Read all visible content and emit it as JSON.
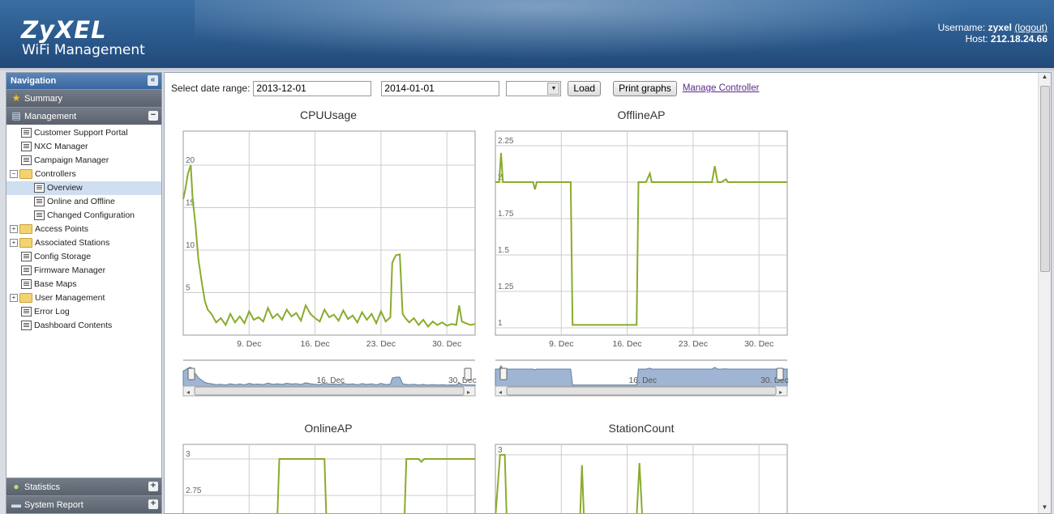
{
  "header": {
    "brand": "ZyXEL",
    "subtitle": "WiFi Management",
    "username_label": "Username:",
    "username": "zyxel",
    "logout": "(logout)",
    "host_label": "Host:",
    "host": "212.18.24.66"
  },
  "sidebar": {
    "title": "Navigation",
    "sections": {
      "summary": "Summary",
      "management": "Management",
      "statistics": "Statistics",
      "system_report": "System Report"
    },
    "items": [
      {
        "label": "Customer Support Portal"
      },
      {
        "label": "NXC Manager"
      },
      {
        "label": "Campaign Manager"
      },
      {
        "label": "Controllers"
      },
      {
        "label": "Overview"
      },
      {
        "label": "Online and Offline"
      },
      {
        "label": "Changed Configuration"
      },
      {
        "label": "Access Points"
      },
      {
        "label": "Associated Stations"
      },
      {
        "label": "Config Storage"
      },
      {
        "label": "Firmware Manager"
      },
      {
        "label": "Base Maps"
      },
      {
        "label": "User Management"
      },
      {
        "label": "Error Log"
      },
      {
        "label": "Dashboard Contents"
      }
    ]
  },
  "toolbar": {
    "date_label": "Select date range:",
    "start_date": "2013-12-01",
    "end_date": "2014-01-01",
    "select_value": "",
    "load": "Load",
    "print": "Print graphs",
    "manage": "Manage Controller"
  },
  "colors": {
    "line": "#8aab2c",
    "nav_fill": "#9fb5d3",
    "header": "#2b5a8d"
  },
  "chart_data": [
    {
      "type": "line",
      "title": "CPUUsage",
      "x_ticks": [
        "9. Dec",
        "16. Dec",
        "23. Dec",
        "30. Dec"
      ],
      "y_ticks": [
        "5",
        "10",
        "15",
        "20"
      ],
      "ylim": [
        0,
        24
      ],
      "x": [
        1,
        1.2,
        1.5,
        1.8,
        2,
        2.3,
        2.6,
        3,
        3.3,
        3.6,
        4,
        4.5,
        5,
        5.5,
        6,
        6.5,
        7,
        7.5,
        8,
        8.5,
        9,
        9.5,
        10,
        10.5,
        11,
        11.5,
        12,
        12.5,
        13,
        13.5,
        14,
        14.5,
        15,
        15.5,
        16,
        16.5,
        17,
        17.5,
        18,
        18.5,
        19,
        19.5,
        20,
        20.5,
        21,
        21.5,
        22,
        22.5,
        23,
        23.2,
        23.4,
        23.6,
        24,
        24.3,
        24.6,
        25,
        25.5,
        26,
        26.5,
        27,
        27.5,
        28,
        28.5,
        29,
        29.5,
        30,
        30.3,
        30.6,
        31,
        31.5,
        32
      ],
      "values": [
        16,
        17,
        19,
        20,
        16,
        13,
        9,
        6,
        4,
        3,
        2.5,
        1.5,
        2,
        1.2,
        2.5,
        1.5,
        2.2,
        1.4,
        2.8,
        1.8,
        2.1,
        1.6,
        3.2,
        2.0,
        2.5,
        1.8,
        3.0,
        2.2,
        2.6,
        1.7,
        3.5,
        2.5,
        2.0,
        1.6,
        3.0,
        2.1,
        2.4,
        1.7,
        2.9,
        1.9,
        2.3,
        1.5,
        2.7,
        1.8,
        2.5,
        1.4,
        2.8,
        1.6,
        2.1,
        8.5,
        9.0,
        9.4,
        9.5,
        2.5,
        2.0,
        1.5,
        2.0,
        1.2,
        1.8,
        1.0,
        1.6,
        1.2,
        1.5,
        1.1,
        1.3,
        1.2,
        3.5,
        1.6,
        1.4,
        1.2,
        1.3
      ]
    },
    {
      "type": "line",
      "title": "OfflineAP",
      "x_ticks": [
        "9. Dec",
        "16. Dec",
        "23. Dec",
        "30. Dec"
      ],
      "y_ticks": [
        "1",
        "1.25",
        "1.5",
        "1.75",
        "2",
        "2.25"
      ],
      "ylim": [
        0.95,
        2.35
      ],
      "x": [
        1,
        1.4,
        1.6,
        1.8,
        3,
        5,
        5.2,
        5.4,
        7,
        9,
        9.2,
        11,
        11.2,
        13,
        16,
        16.2,
        16.4,
        17,
        17.4,
        17.6,
        18,
        23,
        24,
        24.3,
        24.6,
        25,
        25.5,
        25.7,
        26,
        32
      ],
      "values": [
        2,
        2,
        2.2,
        2,
        2,
        2,
        1.95,
        2,
        2,
        2,
        1.02,
        1.02,
        1.02,
        1.02,
        1.02,
        2,
        2,
        2,
        2.06,
        2,
        2,
        2,
        2,
        2.11,
        2,
        2,
        2.02,
        2,
        2,
        2
      ]
    },
    {
      "type": "line",
      "title": "OnlineAP",
      "x_ticks": [],
      "y_ticks": [
        "2.75",
        "3"
      ],
      "ylim": [
        2.6,
        3.1
      ],
      "x": [
        1,
        11,
        11.2,
        16,
        16.2,
        24.5,
        24.7,
        26,
        26.3,
        26.6,
        32
      ],
      "values": [
        2.3,
        2.3,
        3.0,
        3.0,
        2.3,
        2.3,
        3.0,
        3.0,
        2.98,
        3.0,
        3.0
      ]
    },
    {
      "type": "line",
      "title": "StationCount",
      "x_ticks": [],
      "y_ticks": [
        "3"
      ],
      "ylim": [
        0,
        3.5
      ],
      "x": [
        1,
        1.5,
        2,
        2.2,
        2.6,
        3,
        10,
        10.2,
        10.4,
        10.6,
        11,
        16,
        16.3,
        16.6,
        17,
        32
      ],
      "values": [
        0,
        3,
        3,
        0,
        0,
        0,
        0,
        2.5,
        0,
        0,
        0,
        0,
        2.6,
        0,
        0,
        0
      ]
    }
  ],
  "navigators": [
    {
      "labels": [
        "16. Dec",
        "30. Dec"
      ]
    },
    {
      "labels": [
        "16. Dec",
        "30. Dec"
      ]
    }
  ]
}
